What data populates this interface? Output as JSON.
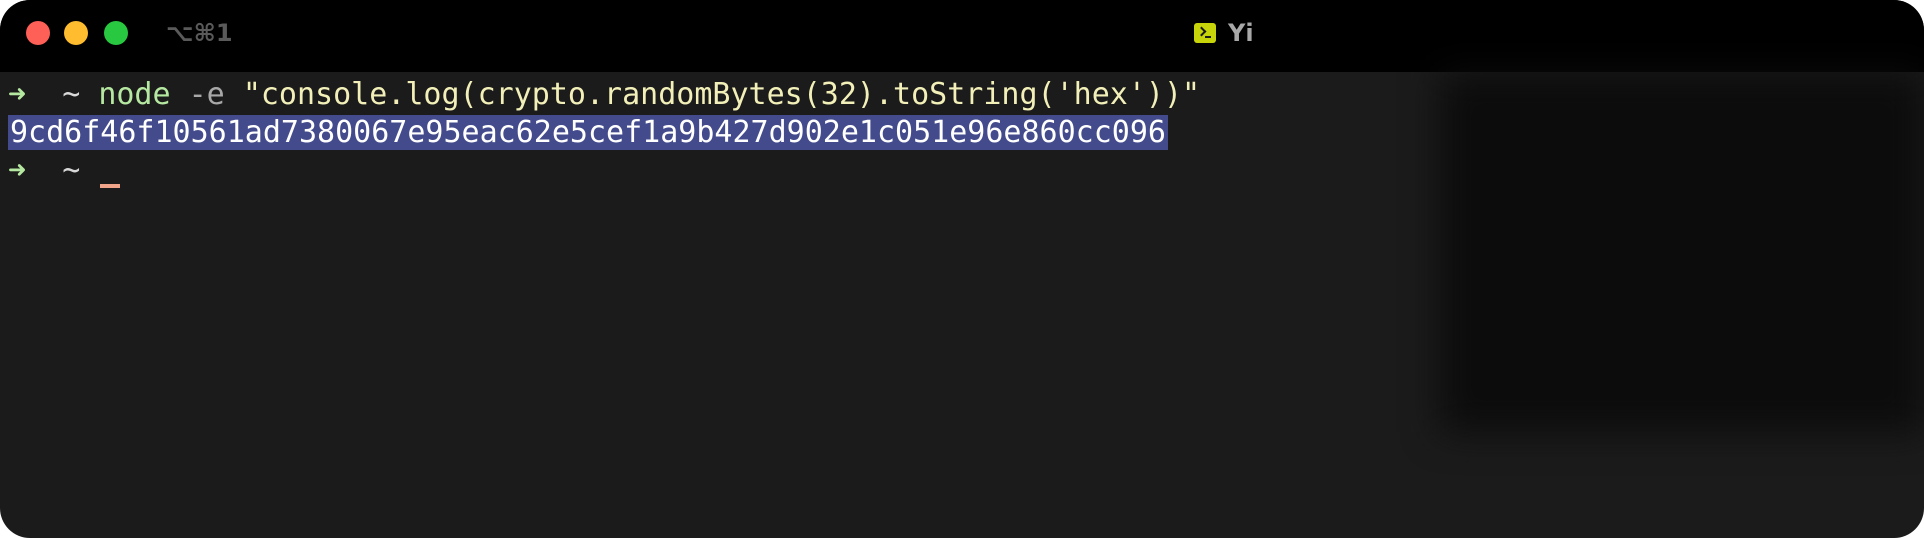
{
  "window": {
    "tab_shortcut": "⌥⌘1",
    "title": "Yi",
    "title_icon": "terminal-icon"
  },
  "terminal": {
    "line1": {
      "prompt_arrow": "➜",
      "cwd": "~",
      "command": "node",
      "flag": "-e",
      "argument": "\"console.log(crypto.randomBytes(32).toString('hex'))\""
    },
    "output": "9cd6f46f10561ad7380067e95eac62e5cef1a9b427d902e1c051e96e860cc096",
    "line3": {
      "prompt_arrow": "➜",
      "cwd": "~"
    }
  },
  "colors": {
    "background": "#1b1b1b",
    "titlebar": "#000000",
    "selection": "#434b8c",
    "prompt": "#b5e8a0",
    "string": "#f2f0b8",
    "cursor": "#f0a58a"
  }
}
